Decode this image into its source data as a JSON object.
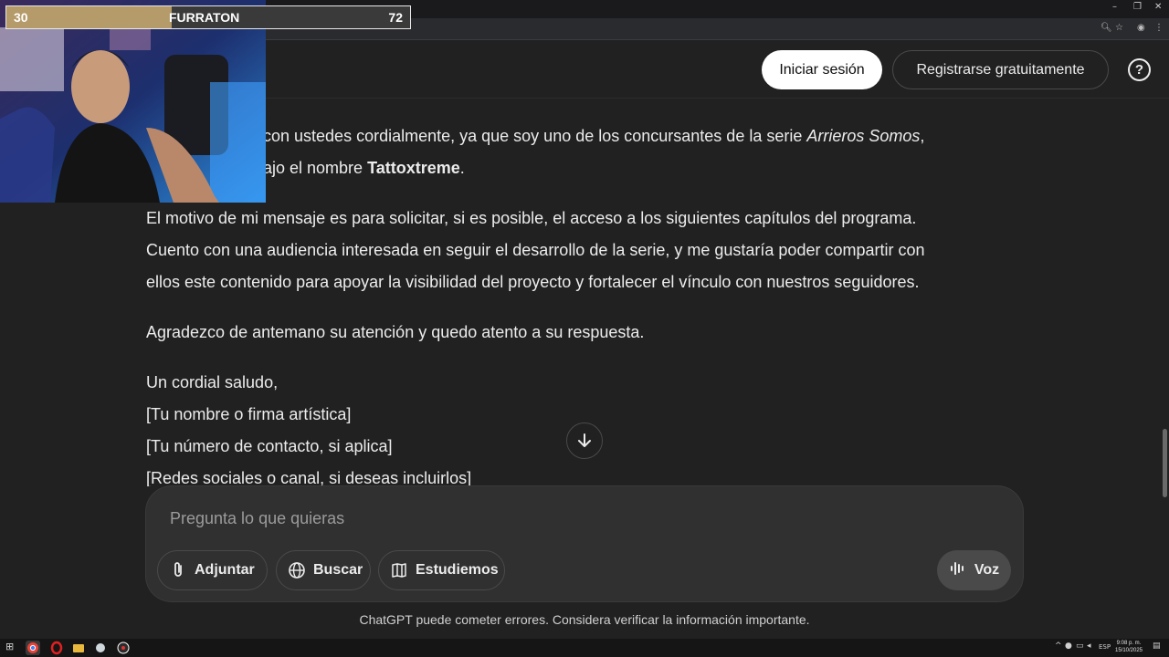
{
  "browser": {
    "window_controls": [
      "–",
      "❐",
      "✕"
    ],
    "toolbar_icons": [
      "zoom-icon",
      "star-icon",
      "profile-icon",
      "menu-icon"
    ]
  },
  "header": {
    "login_label": "Iniciar sesión",
    "register_label": "Registrarse gratuitamente",
    "help_label": "?"
  },
  "message": {
    "p1_line1_a": "con ustedes cordialmente, ya que soy uno de los concursantes de la serie ",
    "p1_line1_italic": "Arrieros Somos",
    "p1_line1_b": ",",
    "p1_line2_a": "ajo el nombre ",
    "p1_line2_bold": "Tattoxtreme",
    "p1_line2_b": ".",
    "p2_lines": [
      "El motivo de mi mensaje es para solicitar, si es posible, el acceso a los siguientes capítulos del programa.",
      "Cuento con una audiencia interesada en seguir el desarrollo de la serie, y me gustaría poder compartir con",
      "ellos este contenido para apoyar la visibilidad del proyecto y fortalecer el vínculo con nuestros seguidores."
    ],
    "p3": "Agradezco de antemano su atención y quedo atento a su respuesta.",
    "closing": [
      "Un cordial saludo,",
      "[Tu nombre o firma artística]",
      "[Tu número de contacto, si aplica]",
      "[Redes sociales o canal, si deseas incluirlos]"
    ]
  },
  "composer": {
    "placeholder": "Pregunta lo que quieras",
    "attach_label": "Adjuntar",
    "search_label": "Buscar",
    "study_label": "Estudiemos",
    "voice_label": "Voz"
  },
  "disclaimer": "ChatGPT puede cometer errores. Considera verificar la información importante.",
  "overlay": {
    "level": "30",
    "name": "FURRATON",
    "value": "72",
    "progress_fraction": 0.41
  },
  "taskbar": {
    "lang": "ESP",
    "time": "9:08 p. m.",
    "date": "15/10/2025"
  }
}
